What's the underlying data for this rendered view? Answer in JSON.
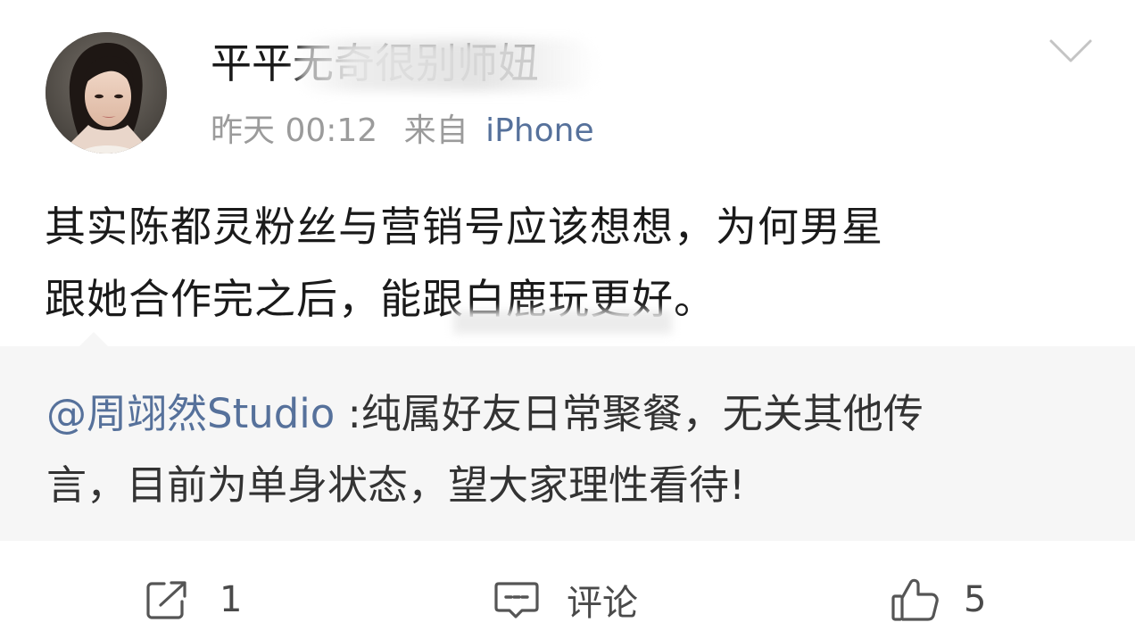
{
  "post": {
    "username": "平平无奇很别师妞",
    "time": "昨天 00:12",
    "source_prefix": "来自",
    "source_device": "iPhone",
    "text_lines": [
      "其实陈都灵粉丝与营销号应该想想，为何男星",
      "跟她合作完之后，能跟白鹿玩更好。"
    ]
  },
  "quote": {
    "mention": "@周翊然Studio",
    "line1_rest": " :纯属好友日常聚餐，无关其他传",
    "line2": "言，目前为单身状态，望大家理性看待!"
  },
  "actions": {
    "repost_count": "1",
    "comment_label": "评论",
    "like_count": "5"
  },
  "icons": {
    "menu": "chevron-down-icon",
    "repost": "repost-icon",
    "comment": "comment-icon",
    "like": "thumbs-up-icon"
  },
  "colors": {
    "link": "#56719b",
    "meta": "#9b9b9b",
    "text": "#1a1a1a",
    "quote_bg": "#f6f6f6"
  }
}
